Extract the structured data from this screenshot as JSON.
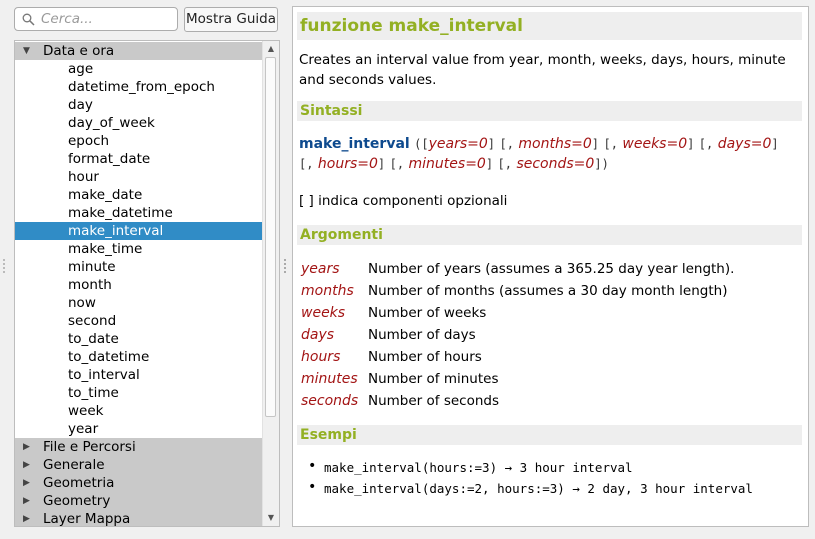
{
  "search": {
    "placeholder": "Cerca..."
  },
  "help_button": {
    "label": "Mostra Guida"
  },
  "tree": {
    "expanded_group": "Data e ora",
    "items": [
      "age",
      "datetime_from_epoch",
      "day",
      "day_of_week",
      "epoch",
      "format_date",
      "hour",
      "make_date",
      "make_datetime",
      "make_interval",
      "make_time",
      "minute",
      "month",
      "now",
      "second",
      "to_date",
      "to_datetime",
      "to_interval",
      "to_time",
      "week",
      "year"
    ],
    "selected": "make_interval",
    "collapsed_groups": [
      "File e Percorsi",
      "Generale",
      "Geometria",
      "Geometry",
      "Layer Mappa"
    ]
  },
  "help": {
    "title": "funzione make_interval",
    "description": "Creates an interval value from year, month, weeks, days, hours, minute and seconds values.",
    "syntax_heading": "Sintassi",
    "function_name": "make_interval",
    "syntax_args": [
      "years=0",
      "months=0",
      "weeks=0",
      "days=0",
      "hours=0",
      "minutes=0",
      "seconds=0"
    ],
    "optional_note": "[ ] indica componenti opzionali",
    "arguments_heading": "Argomenti",
    "arguments": [
      {
        "name": "years",
        "desc": "Number of years (assumes a 365.25 day year length)."
      },
      {
        "name": "months",
        "desc": "Number of months (assumes a 30 day month length)"
      },
      {
        "name": "weeks",
        "desc": "Number of weeks"
      },
      {
        "name": "days",
        "desc": "Number of days"
      },
      {
        "name": "hours",
        "desc": "Number of hours"
      },
      {
        "name": "minutes",
        "desc": "Number of minutes"
      },
      {
        "name": "seconds",
        "desc": "Number of seconds"
      }
    ],
    "examples_heading": "Esempi",
    "examples": [
      "make_interval(hours:=3) → 3 hour interval",
      "make_interval(days:=2, hours:=3) → 2 day, 3 hour interval"
    ]
  },
  "colors": {
    "heading": "#93b023",
    "selection": "#308cc6",
    "argument": "#a31515",
    "function": "#0e4a8e"
  }
}
